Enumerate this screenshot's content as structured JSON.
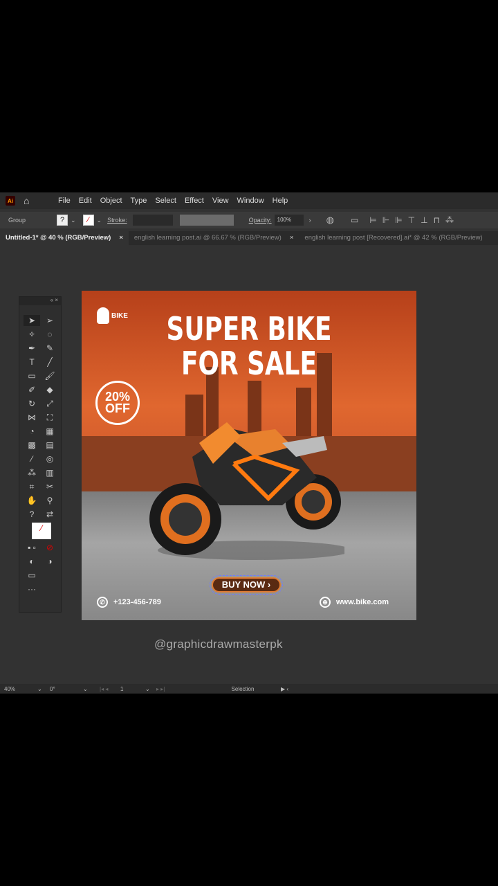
{
  "menubar": {
    "logo": "Ai",
    "items": [
      "File",
      "Edit",
      "Object",
      "Type",
      "Select",
      "Effect",
      "View",
      "Window",
      "Help"
    ]
  },
  "control": {
    "selection": "Group",
    "fill": "?",
    "stroke_label": "Stroke:",
    "opacity_label": "Opacity:",
    "opacity": "100%"
  },
  "tabs": [
    {
      "label": "Untitled-1* @ 40 % (RGB/Preview)",
      "active": true
    },
    {
      "label": "english learning post.ai @ 66.67 % (RGB/Preview)",
      "active": false
    },
    {
      "label": "english learning post [Recovered].ai* @ 42 % (RGB/Preview)",
      "active": false
    }
  ],
  "poster": {
    "brand": "BIKE",
    "title1": "SUPER BIKE",
    "title2": "FOR SALE",
    "badge1": "20%",
    "badge2": "OFF",
    "button": "BUY NOW ›",
    "phone": "+123-456-789",
    "website": "www.bike.com",
    "colors": {
      "accent": "#e07b32",
      "sky": "#c95a2b"
    }
  },
  "watermark": "@graphicdrawmasterpk",
  "status": {
    "zoom": "40%",
    "rotation": "0°",
    "page": "1",
    "tool": "Selection"
  }
}
